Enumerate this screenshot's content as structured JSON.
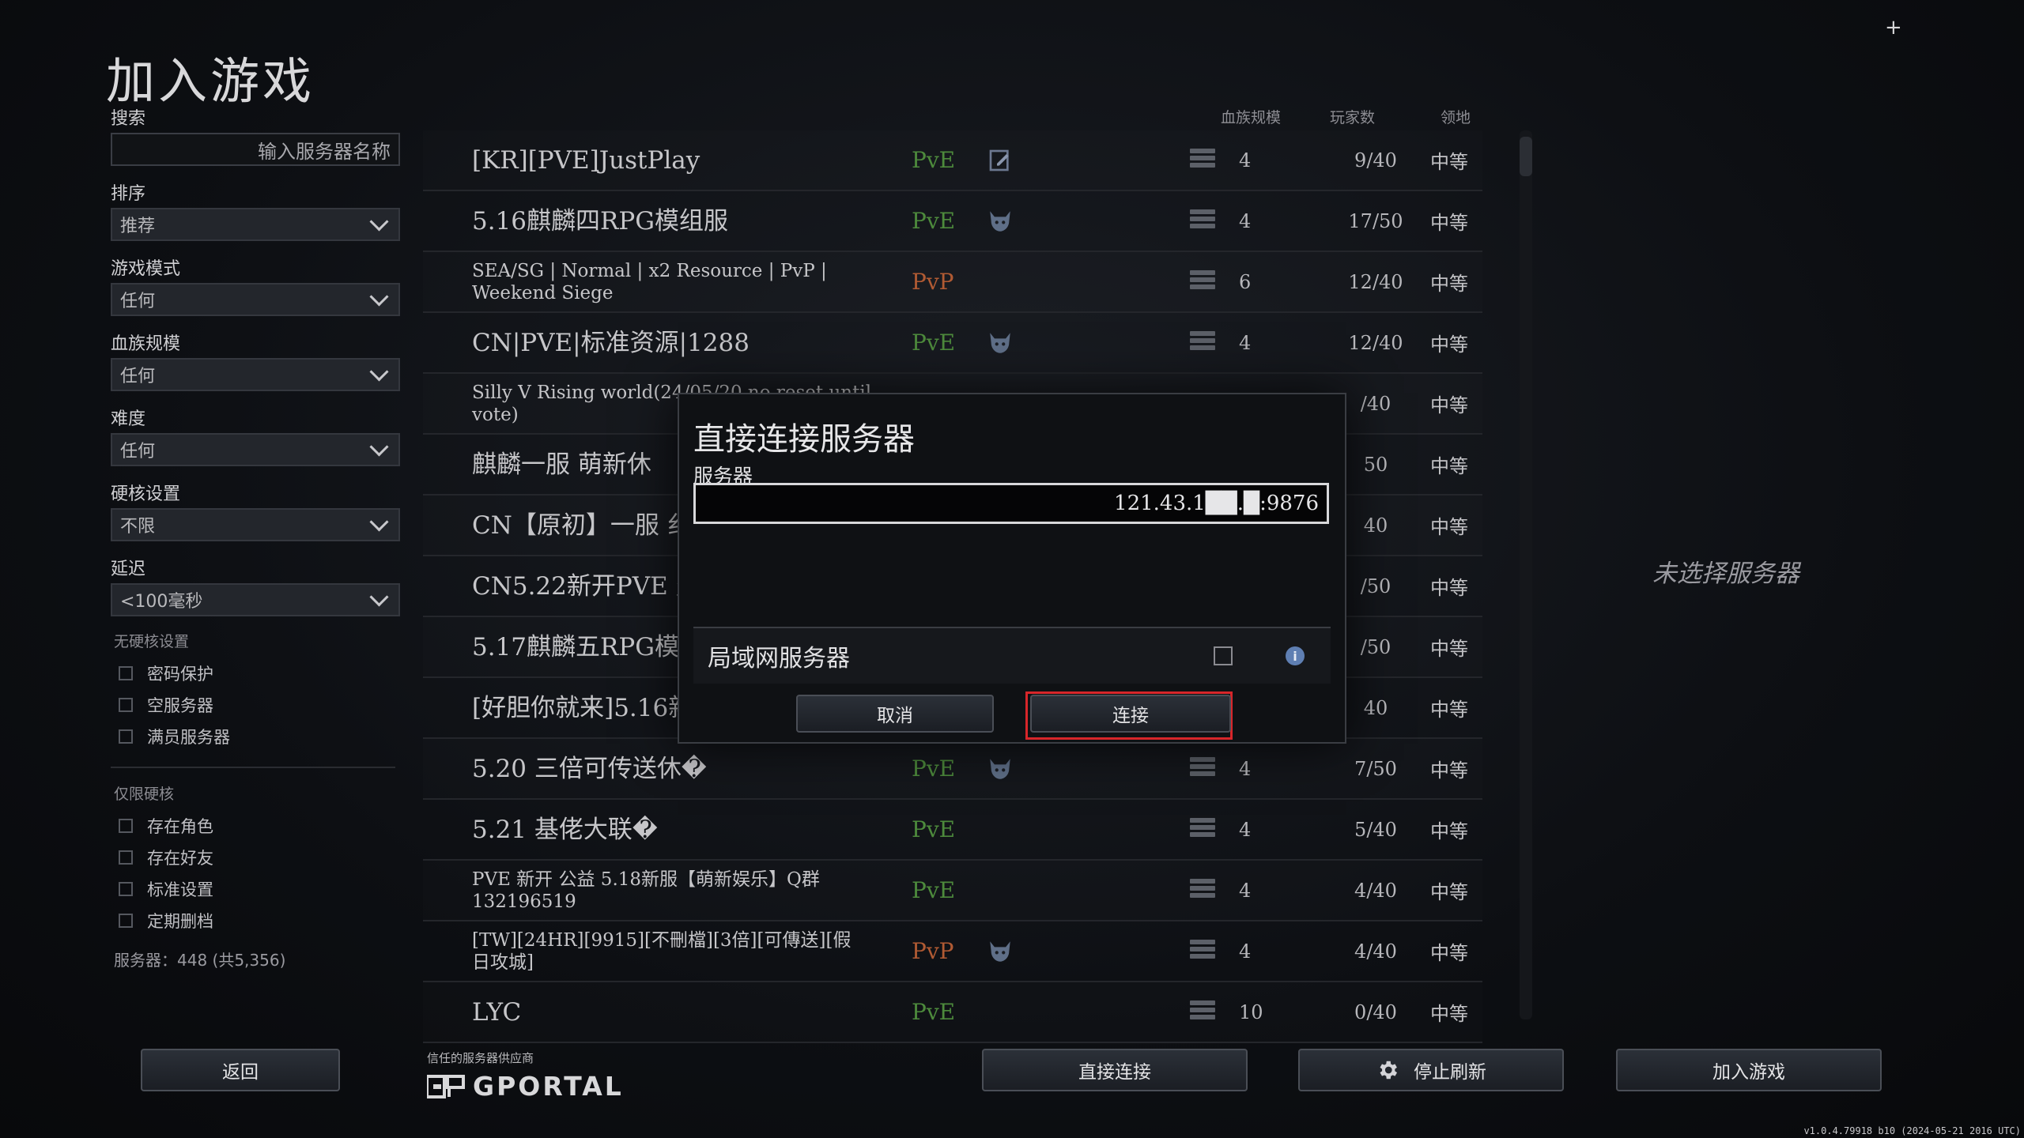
{
  "page_title": "加入游戏",
  "filters": {
    "search_label": "搜索",
    "search_placeholder": "输入服务器名称",
    "sort_label": "排序",
    "sort_value": "推荐",
    "mode_label": "游戏模式",
    "mode_value": "任何",
    "clan_label": "血族规模",
    "clan_value": "任何",
    "difficulty_label": "难度",
    "difficulty_value": "任何",
    "hardcore_label": "硬核设置",
    "hardcore_value": "不限",
    "latency_label": "延迟",
    "latency_value": "<100毫秒",
    "non_hardcore_section": "无硬核设置",
    "non_hardcore_options": [
      "密码保护",
      "空服务器",
      "满员服务器"
    ],
    "hardcore_only_section": "仅限硬核",
    "hardcore_only_options": [
      "存在角色",
      "存在好友",
      "标准设置",
      "定期删档"
    ],
    "server_count": "服务器：448 (共5,356)"
  },
  "columns": {
    "clan": "血族规模",
    "players": "玩家数",
    "territory": "领地"
  },
  "servers": [
    {
      "name": "[KR][PVE]JustPlay",
      "mode": "PvE",
      "icon": "edit-icon",
      "clan": "4",
      "players": "9/40",
      "territory": "中等"
    },
    {
      "name": "5.16麒麟四RPG模组服",
      "mode": "PvE",
      "icon": "wolf-icon",
      "clan": "4",
      "players": "17/50",
      "territory": "中等"
    },
    {
      "name": "SEA/SG | Normal | x2 Resource | PvP | Weekend Siege",
      "mode": "PvP",
      "icon": "",
      "clan": "6",
      "players": "12/40",
      "territory": "中等"
    },
    {
      "name": "CN|PVE|标准资源|1288",
      "mode": "PvE",
      "icon": "wolf-icon",
      "clan": "4",
      "players": "12/40",
      "territory": "中等"
    },
    {
      "name": "Silly V Rising world(24/05/20 no reset until vote)",
      "mode": "",
      "icon": "",
      "clan": "",
      "players": "/40",
      "territory": "中等"
    },
    {
      "name": "麒麟一服  萌新休",
      "mode": "",
      "icon": "",
      "clan": "",
      "players": "50",
      "territory": "中等"
    },
    {
      "name": "CN【原初】一服 纟",
      "mode": "",
      "icon": "",
      "clan": "",
      "players": "40",
      "territory": "中等"
    },
    {
      "name": "CN5.22新开PVE 叠加",
      "mode": "",
      "icon": "",
      "clan": "",
      "players": "/50",
      "territory": "中等"
    },
    {
      "name": "5.17麒麟五RPG模",
      "mode": "",
      "icon": "",
      "clan": "",
      "players": "/50",
      "territory": "中等"
    },
    {
      "name": "[好胆你就来]5.16新",
      "mode": "",
      "icon": "",
      "clan": "",
      "players": "40",
      "territory": "中等"
    },
    {
      "name": "5.20 三倍可传送休�",
      "mode": "PvE",
      "icon": "wolf-icon",
      "clan": "4",
      "players": "7/50",
      "territory": "中等"
    },
    {
      "name": "5.21 基佬大联�",
      "mode": "PvE",
      "icon": "",
      "clan": "4",
      "players": "5/40",
      "territory": "中等"
    },
    {
      "name": "PVE 新开 公益 5.18新服【萌新娱乐】Q群132196519",
      "mode": "PvE",
      "icon": "",
      "clan": "4",
      "players": "4/40",
      "territory": "中等"
    },
    {
      "name": "[TW][24HR][9915][不刪檔][3倍][可傳送][假日攻城]",
      "mode": "PvP",
      "icon": "wolf-icon",
      "clan": "4",
      "players": "4/40",
      "territory": "中等"
    },
    {
      "name": "LYC",
      "mode": "PvE",
      "icon": "",
      "clan": "10",
      "players": "0/40",
      "territory": "中等"
    }
  ],
  "no_server_selected": "未选择服务器",
  "dialog": {
    "title": "直接连接服务器",
    "server_label": "服务器",
    "server_value": "121.43.1██.█:9876",
    "lan_label": "局域网服务器",
    "info_glyph": "i",
    "cancel": "取消",
    "connect": "连接"
  },
  "bottom": {
    "back": "返回",
    "provider_label": "信任的服务器供应商",
    "provider_name": "GPORTAL",
    "direct_connect": "直接连接",
    "stop_refresh": "停止刷新",
    "join_game": "加入游戏"
  },
  "version": "v1.0.4.79918 b10 (2024-05-21 2016 UTC)",
  "colors": {
    "pve": "#4d8a3c",
    "pvp": "#b05a33",
    "connect_highlight": "#d7262a"
  }
}
